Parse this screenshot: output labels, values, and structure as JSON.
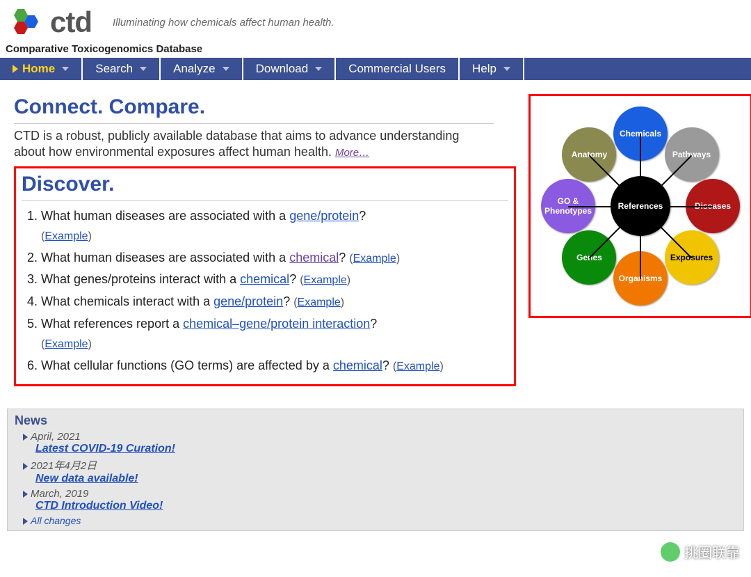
{
  "header": {
    "logo_text": "ctd",
    "tagline": "Illuminating how chemicals affect human health.",
    "subtitle": "Comparative Toxicogenomics Database"
  },
  "nav": {
    "items": [
      "Home",
      "Search",
      "Analyze",
      "Download",
      "Commercial Users",
      "Help"
    ],
    "has_dropdown": [
      true,
      true,
      true,
      true,
      false,
      true
    ],
    "active": 0
  },
  "sections": {
    "connect_title": "Connect. Compare.",
    "intro_text": "CTD is a robust, publicly available database that aims to advance understanding about how environmental exposures affect human health. ",
    "more_label": "More…",
    "discover_title": "Discover."
  },
  "discover": [
    {
      "pre": "What human diseases are associated with a ",
      "link": "gene/protein",
      "post": "?",
      "ex": "Example",
      "inline_ex": false
    },
    {
      "pre": "What human diseases are associated with a ",
      "link": "chemical",
      "post": "?",
      "ex": "Example",
      "inline_ex": true,
      "visited": true
    },
    {
      "pre": "What genes/proteins interact with a ",
      "link": "chemical",
      "post": "?",
      "ex": "Example",
      "inline_ex": true
    },
    {
      "pre": "What chemicals interact with a ",
      "link": "gene/protein",
      "post": "?",
      "ex": "Example",
      "inline_ex": true
    },
    {
      "pre": "What references report a ",
      "link": "chemical–gene/protein interaction",
      "post": "?",
      "ex": "Example",
      "inline_ex": false
    },
    {
      "pre": "What cellular functions (GO terms) are affected by a ",
      "link": "chemical",
      "post": "?",
      "ex": "Example",
      "inline_ex": true
    }
  ],
  "hub": {
    "center": "References",
    "nodes": [
      {
        "label": "Chemicals",
        "color": "#1a5fe0"
      },
      {
        "label": "Pathways",
        "color": "#9a9a9a"
      },
      {
        "label": "Diseases",
        "color": "#b01818"
      },
      {
        "label": "Exposures",
        "color": "#f0c400"
      },
      {
        "label": "Organisms",
        "color": "#f07800"
      },
      {
        "label": "Genes",
        "color": "#0a8a0a"
      },
      {
        "label": "GO & Phenotypes",
        "color": "#8a5ae0"
      },
      {
        "label": "Anatomy",
        "color": "#8a8a50"
      }
    ]
  },
  "news": {
    "title": "News",
    "items": [
      {
        "date": "April, 2021",
        "headline": "Latest COVID-19 Curation!"
      },
      {
        "date": "2021年4月2日",
        "headline": "New data available!"
      },
      {
        "date": "March, 2019",
        "headline": "CTD Introduction Video!"
      }
    ],
    "all_changes": "All changes"
  },
  "watermark": "挑圈联靠"
}
